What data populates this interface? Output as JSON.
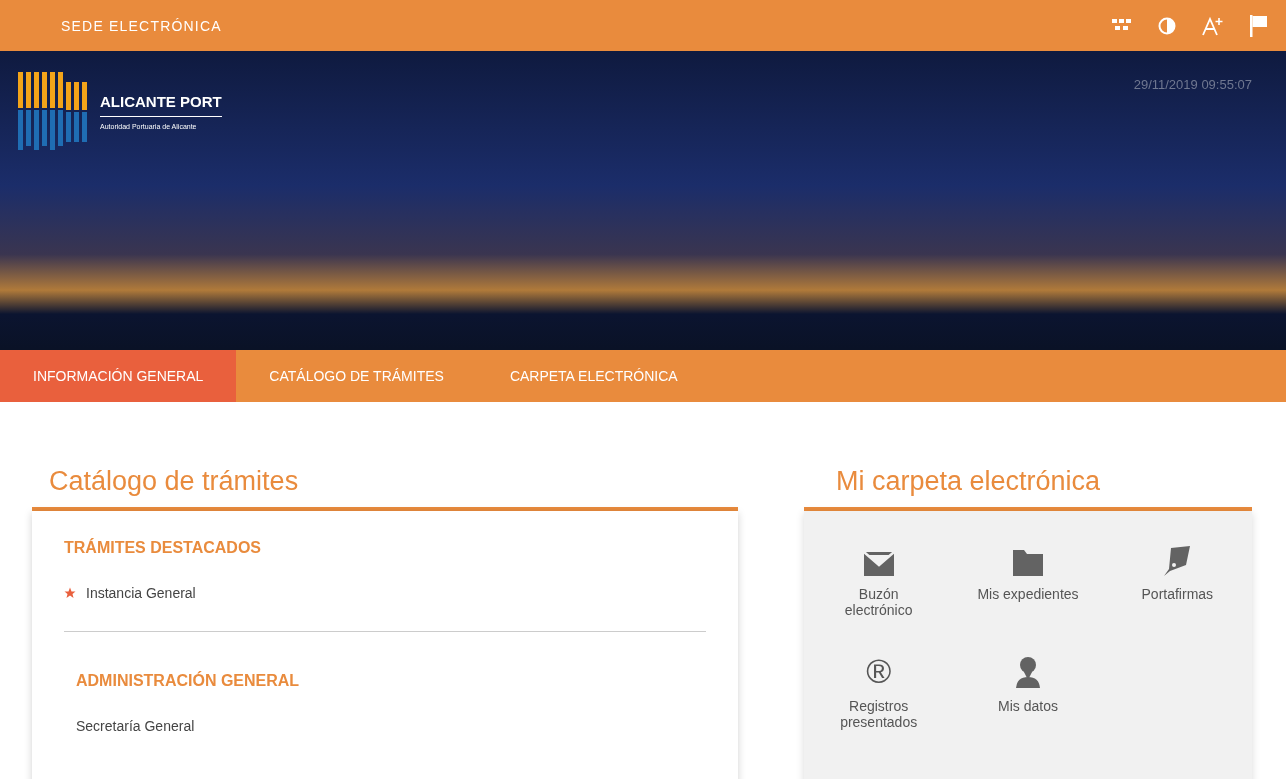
{
  "top_bar": {
    "title": "SEDE ELECTRÓNICA",
    "tools": [
      {
        "kind": "grid"
      },
      {
        "kind": "contrast"
      },
      {
        "kind": "font-size"
      },
      {
        "kind": "flag"
      }
    ]
  },
  "banner": {
    "logo_name": "ALICANTE PORT",
    "logo_subtitle": "Autoridad Portuaria de Alicante",
    "datetime": "29/11/2019 09:55:07"
  },
  "nav": [
    {
      "label": "INFORMACIÓN GENERAL",
      "selected": true
    },
    {
      "label": "CATÁLOGO DE TRÁMITES",
      "selected": false
    },
    {
      "label": "CARPETA ELECTRÓNICA",
      "selected": false
    }
  ],
  "catalog": {
    "title": "Catálogo de trámites",
    "sections": [
      {
        "heading": "TRÁMITES DESTACADOS",
        "items": [
          {
            "label": "Instancia General",
            "starred": true
          }
        ]
      },
      {
        "heading": "ADMINISTRACIÓN GENERAL",
        "items": [
          {
            "label": "Secretaría General",
            "starred": false
          }
        ]
      }
    ]
  },
  "folder": {
    "title": "Mi carpeta electrónica",
    "items": [
      {
        "kind": "mail",
        "label": "Buzón electrónico"
      },
      {
        "kind": "folder",
        "label": "Mis expedientes"
      },
      {
        "kind": "pen",
        "label": "Portafirmas"
      },
      {
        "kind": "glyph",
        "glyph": "®",
        "label": "Registros presentados"
      },
      {
        "kind": "user",
        "label": "Mis datos"
      }
    ]
  }
}
